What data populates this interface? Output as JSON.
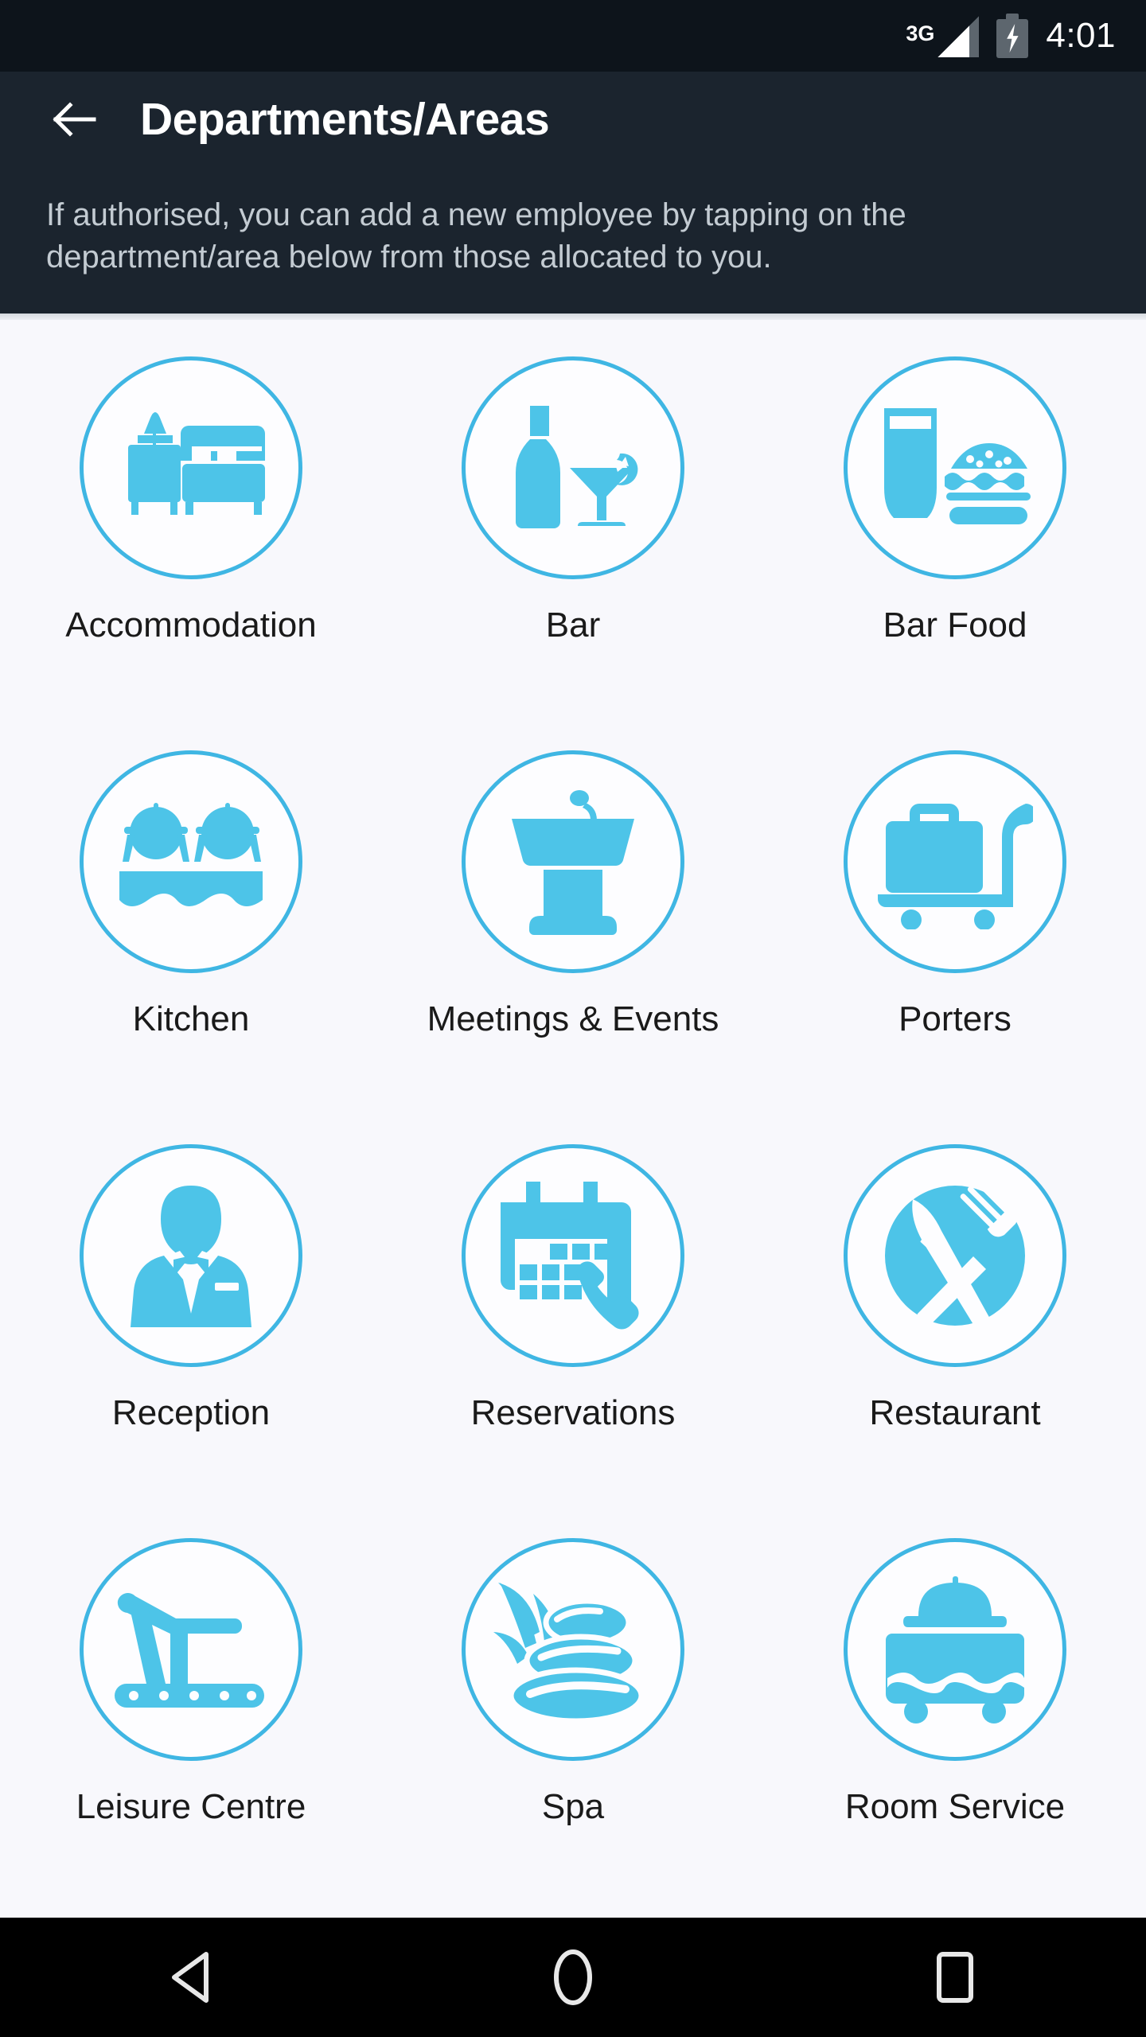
{
  "status_bar": {
    "network_label": "3G",
    "network_icon": "signal-3g-icon",
    "battery_icon": "battery-charging-icon",
    "time": "4:01"
  },
  "app_bar": {
    "back_icon": "back-arrow-icon",
    "title": "Departments/Areas",
    "subtitle": "If authorised, you can add a new employee by tapping on the department/area below from those allocated to you."
  },
  "colors": {
    "accent": "#3fb6e3",
    "icon_fill": "#4dc4e8",
    "header_bg": "#1b242e",
    "statusbar_bg": "#0d141b",
    "page_bg": "#f8f8fc",
    "label_text": "#1a1a1a",
    "subtitle_text": "#c3cbd2"
  },
  "departments": [
    {
      "label": "Accommodation",
      "icon": "bed-nightstand-icon"
    },
    {
      "label": "Bar",
      "icon": "bottle-cocktail-icon"
    },
    {
      "label": "Bar Food",
      "icon": "beer-burger-icon"
    },
    {
      "label": "Kitchen",
      "icon": "cloches-table-icon"
    },
    {
      "label": "Meetings & Events",
      "icon": "podium-microphone-icon"
    },
    {
      "label": "Porters",
      "icon": "luggage-cart-icon"
    },
    {
      "label": "Reception",
      "icon": "concierge-person-icon"
    },
    {
      "label": "Reservations",
      "icon": "calendar-phone-icon"
    },
    {
      "label": "Restaurant",
      "icon": "knife-fork-circle-icon"
    },
    {
      "label": "Leisure Centre",
      "icon": "treadmill-icon"
    },
    {
      "label": "Spa",
      "icon": "hot-stones-leaves-icon"
    },
    {
      "label": "Room Service",
      "icon": "serving-trolley-icon"
    }
  ],
  "nav_bar": {
    "back_label": "Back",
    "home_label": "Home",
    "recents_label": "Recents"
  }
}
